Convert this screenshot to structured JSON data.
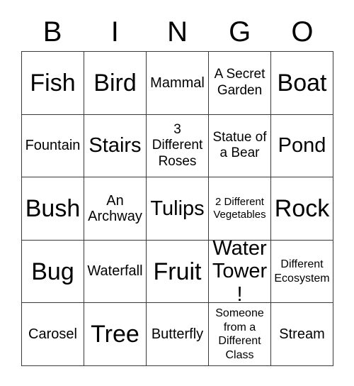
{
  "card": {
    "title_letters": [
      "B",
      "I",
      "N",
      "G",
      "O"
    ],
    "grid_size": "5x5",
    "colors": {
      "background": "#ffffff",
      "text": "#000000",
      "border": "#3a3a3a"
    },
    "rows": [
      [
        {
          "label": "Fish",
          "size": "xl"
        },
        {
          "label": "Bird",
          "size": "xl"
        },
        {
          "label": "Mammal",
          "size": "md"
        },
        {
          "label": "A Secret Garden",
          "size": "sm"
        },
        {
          "label": "Boat",
          "size": "xl"
        }
      ],
      [
        {
          "label": "Fountain",
          "size": "md"
        },
        {
          "label": "Stairs",
          "size": "lg"
        },
        {
          "label": "3 Different Roses",
          "size": "sm"
        },
        {
          "label": "Statue of a Bear",
          "size": "sm"
        },
        {
          "label": "Pond",
          "size": "lg"
        }
      ],
      [
        {
          "label": "Bush",
          "size": "xl"
        },
        {
          "label": "An Archway",
          "size": "md"
        },
        {
          "label": "Tulips",
          "size": "lg"
        },
        {
          "label": "2 Different Vegetables",
          "size": "xxs"
        },
        {
          "label": "Rock",
          "size": "xl"
        }
      ],
      [
        {
          "label": "Bug",
          "size": "xl"
        },
        {
          "label": "Waterfall",
          "size": "md"
        },
        {
          "label": "Fruit",
          "size": "xl"
        },
        {
          "label": "Water Tower!",
          "size": "lg"
        },
        {
          "label": "Different Ecosystem",
          "size": "xs"
        }
      ],
      [
        {
          "label": "Carosel",
          "size": "md"
        },
        {
          "label": "Tree",
          "size": "xl"
        },
        {
          "label": "Butterfly",
          "size": "md"
        },
        {
          "label": "Someone from a Different Class",
          "size": "xs"
        },
        {
          "label": "Stream",
          "size": "md"
        }
      ]
    ]
  }
}
